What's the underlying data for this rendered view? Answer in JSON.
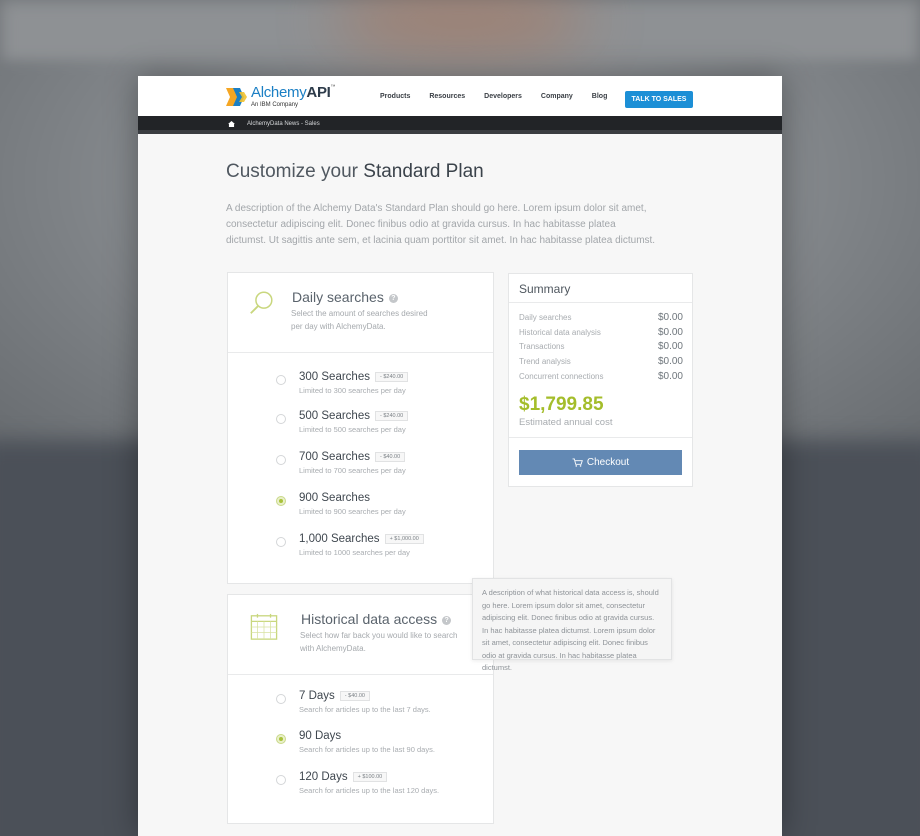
{
  "header": {
    "logo_name_part1": "Alchemy",
    "logo_name_part2": "API",
    "logo_tm": "™",
    "logo_sub": "An IBM Company",
    "nav": [
      "Products",
      "Resources",
      "Developers",
      "Company",
      "Blog"
    ],
    "cta": "TALK TO SALES"
  },
  "breadcrumb": {
    "text": "AlchemyData News - Sales"
  },
  "page": {
    "title_light": "Customize your ",
    "title_bold": "Standard Plan",
    "description": "A description of the Alchemy Data's Standard Plan should go here. Lorem ipsum dolor sit amet, consectetur adipiscing elit. Donec finibus odio at gravida cursus. In hac habitasse platea dictumst. Ut sagittis ante sem, et lacinia quam porttitor sit amet. In hac habitasse platea dictumst."
  },
  "daily_searches": {
    "title": "Daily searches",
    "subtitle": "Select the amount of searches desired per day with AlchemyData.",
    "options": [
      {
        "label": "300 Searches",
        "price": "- $240.00",
        "note": "Limited to 300 searches per day",
        "selected": false
      },
      {
        "label": "500 Searches",
        "price": "- $240.00",
        "note": "Limited to 500 searches per day",
        "selected": false
      },
      {
        "label": "700 Searches",
        "price": "- $40.00",
        "note": "Limited to 700 searches per day",
        "selected": false
      },
      {
        "label": "900 Searches",
        "price": "",
        "note": "Limited to 900 searches per day",
        "selected": true
      },
      {
        "label": "1,000 Searches",
        "price": "+ $1,000.00",
        "note": "Limited to 1000 searches per day",
        "selected": false
      }
    ]
  },
  "historical": {
    "title": "Historical data access",
    "subtitle": "Select how far back you would like to search with AlchemyData.",
    "options": [
      {
        "label": "7 Days",
        "price": "- $40.00",
        "note": "Search for articles up to the last 7 days.",
        "selected": false
      },
      {
        "label": "90 Days",
        "price": "",
        "note": "Search for articles up to the last 90 days.",
        "selected": true
      },
      {
        "label": "120 Days",
        "price": "+ $100.00",
        "note": "Search for articles up to the last 120 days.",
        "selected": false
      }
    ]
  },
  "tooltip": {
    "text": "A description of what historical data access is, should go here. Lorem ipsum dolor sit amet, consectetur adipiscing elit. Donec finibus odio at gravida cursus. In hac habitasse platea dictumst. Lorem ipsum dolor sit amet, consectetur adipiscing elit. Donec finibus odio at gravida cursus. In hac habitasse platea dictumst."
  },
  "summary": {
    "title": "Summary",
    "rows": [
      {
        "label": "Daily searches",
        "value": "$0.00"
      },
      {
        "label": "Historical data analysis",
        "value": "$0.00"
      },
      {
        "label": "Transactions",
        "value": "$0.00"
      },
      {
        "label": "Trend analysis",
        "value": "$0.00"
      },
      {
        "label": "Concurrent connections",
        "value": "$0.00"
      }
    ],
    "total": "$1,799.85",
    "total_label": "Estimated annual cost",
    "checkout": "Checkout"
  },
  "colors": {
    "accent_green": "#a4bd2b",
    "cta_blue": "#1c8fd6",
    "checkout_blue": "#6389b4",
    "dark_bar": "#222427"
  },
  "icons": [
    "home-icon",
    "magnifier-icon",
    "calendar-icon",
    "info-icon",
    "cart-icon"
  ]
}
